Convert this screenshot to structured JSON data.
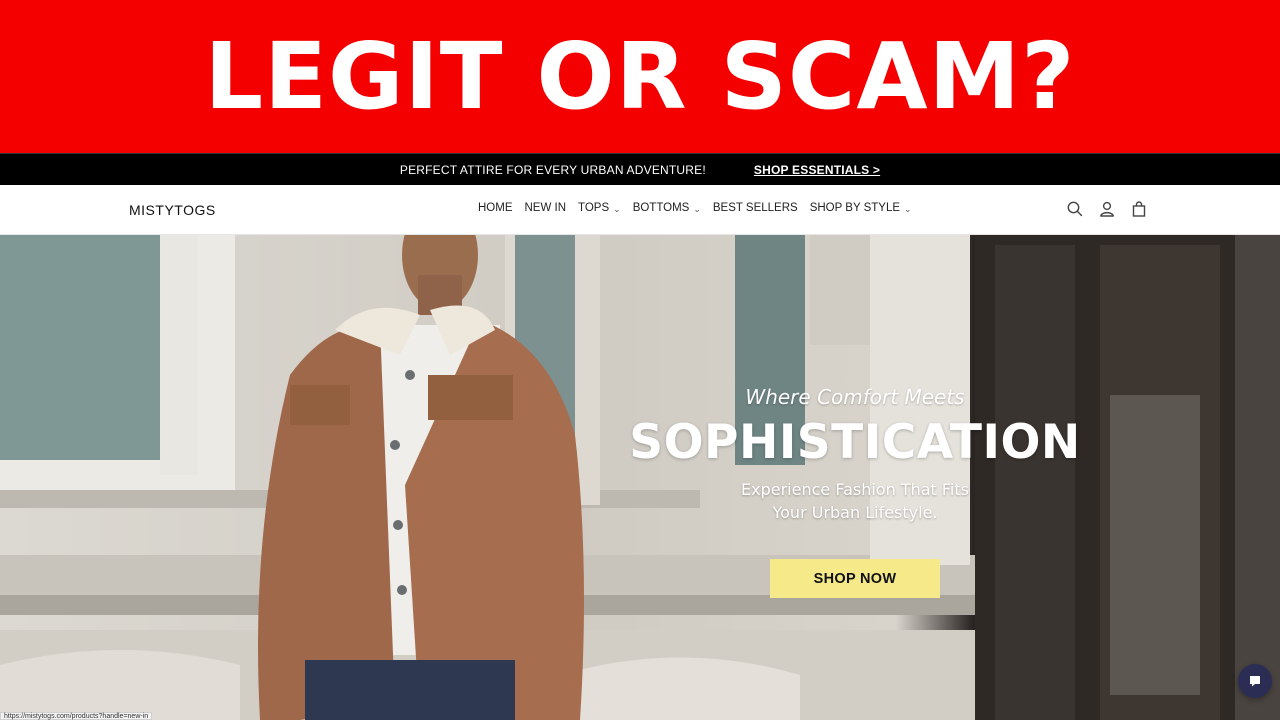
{
  "banner": {
    "title": "LEGIT OR SCAM?"
  },
  "announcement": {
    "message": "PERFECT ATTIRE FOR EVERY URBAN ADVENTURE!",
    "cta": "SHOP ESSENTIALS >"
  },
  "header": {
    "logo": "MISTYTOGS",
    "nav": [
      {
        "label": "HOME",
        "dropdown": false
      },
      {
        "label": "NEW IN",
        "dropdown": false
      },
      {
        "label": "TOPS",
        "dropdown": true
      },
      {
        "label": "BOTTOMS",
        "dropdown": true
      },
      {
        "label": "BEST SELLERS",
        "dropdown": false
      },
      {
        "label": "SHOP BY STYLE",
        "dropdown": true
      }
    ],
    "icons": [
      "search-icon",
      "account-icon",
      "cart-icon"
    ]
  },
  "hero": {
    "kicker": "Where Comfort Meets",
    "headline": "SOPHISTICATION",
    "sub_line1": "Experience Fashion That Fits",
    "sub_line2": "Your Urban Lifestyle.",
    "button": "SHOP NOW",
    "button_color": "#f5e98a"
  },
  "status_bar": {
    "url": "https://mistytogs.com/products?handle=new-in"
  },
  "colors": {
    "banner": "#f50000",
    "announcement_bg": "#000000",
    "chat": "#2b2d54"
  }
}
